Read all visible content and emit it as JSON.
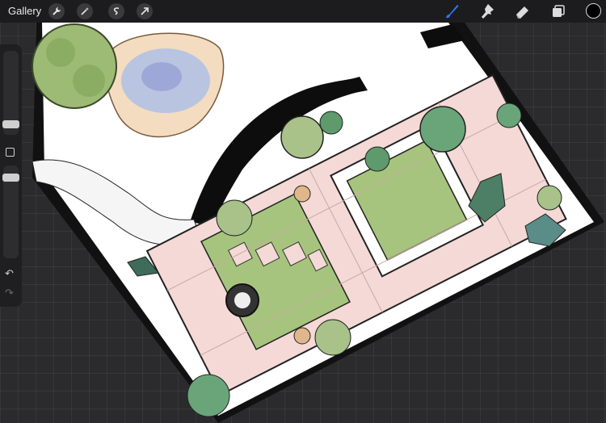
{
  "toolbar": {
    "gallery_label": "Gallery",
    "actions": [
      "wrench-icon",
      "magic-wand-icon",
      "selection-icon",
      "transform-arrow-icon"
    ],
    "tools": [
      "brush-icon",
      "smudge-icon",
      "eraser-icon",
      "layers-icon"
    ],
    "active_tool": "brush",
    "accent_color": "#2f7bf5",
    "current_color": "#000000"
  },
  "sidebar": {
    "brush_size_level": 0.3,
    "opacity_level": 0.55,
    "undo_icon": "undo-icon",
    "redo_icon": "redo-icon"
  },
  "canvas": {
    "subject": "garden-plan-illustration",
    "colors": {
      "paving": "#f4d9d6",
      "lawn": "#a6c47d",
      "shrub": "#5e9a6c",
      "pond": "#b9c4e0",
      "background": "#ffffff",
      "border": "#000000"
    }
  }
}
